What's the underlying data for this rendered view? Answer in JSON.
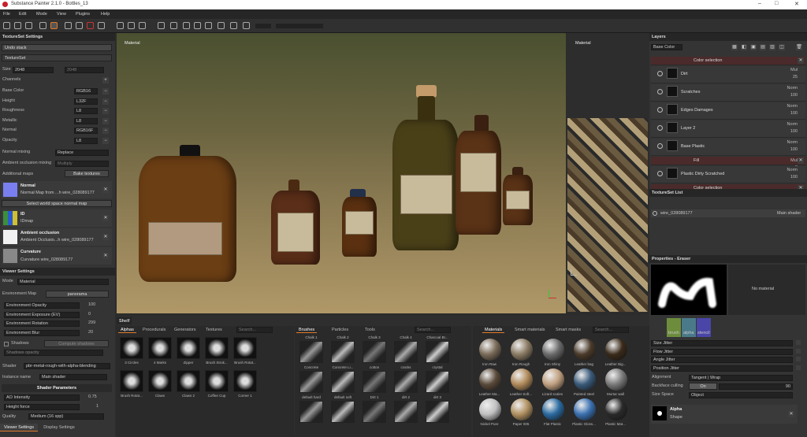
{
  "app": {
    "title": "Substance Painter 2.1.0 - Bottles_13"
  },
  "menu": [
    "File",
    "Edit",
    "Mode",
    "View",
    "Plugins",
    "Help"
  ],
  "textureset_settings": {
    "title": "TextureSet Settings",
    "undo": "Undo stack",
    "tab": "TextureSet",
    "size_label": "Size",
    "size_value": "2048",
    "size_value2": "2048",
    "channels_label": "Channels",
    "channels": [
      {
        "name": "Base Color",
        "format": "RGB16"
      },
      {
        "name": "Height",
        "format": "L32F"
      },
      {
        "name": "Roughness",
        "format": "L8"
      },
      {
        "name": "Metallic",
        "format": "L8"
      },
      {
        "name": "Normal",
        "format": "RGB16F"
      },
      {
        "name": "Opacity",
        "format": "L8"
      }
    ],
    "normal_mixing_label": "Normal mixing",
    "normal_mixing": "Replace",
    "ao_mixing_label": "Ambient occlusion mixing",
    "ao_mixing": "Multiply",
    "additional_maps": "Additional maps",
    "bake_btn": "Bake textures",
    "maps": [
      {
        "title": "Normal",
        "desc": "Normal Map from ...h wire_028089177"
      },
      {
        "title": "ID",
        "desc": "IDmap"
      },
      {
        "title": "Ambient occlusion",
        "desc": "Ambient Occlusio...h wire_028089177"
      },
      {
        "title": "Curvature",
        "desc": "Curvature wire_028089177"
      }
    ],
    "world_btn": "Select world space normal map"
  },
  "viewer_settings": {
    "title": "Viewer Settings",
    "mode_label": "Mode",
    "mode": "Material",
    "env_map_label": "Environment Map",
    "env_map": "panorama",
    "sliders": [
      {
        "label": "Environment Opacity",
        "value": "100"
      },
      {
        "label": "Environment Exposure (EV)",
        "value": "0"
      },
      {
        "label": "Environment Rotation",
        "value": "299"
      },
      {
        "label": "Environment Blur",
        "value": "20"
      }
    ],
    "shadows_label": "Shadows",
    "shadows_btn": "Compute shadows",
    "shadows_opacity": "Shadows opacity",
    "shader_label": "Shader",
    "shader_value": "pbr-metal-rough-with-alpha-blending",
    "instance_label": "Instance name",
    "instance_value": "Main shader",
    "params_title": "Shader Parameters",
    "ao_label": "AO Intensity",
    "ao_value": "0.75",
    "height_label": "Height force",
    "height_value": "1",
    "quality_label": "Quality",
    "quality_value": "Medium (16 spp)",
    "tab1": "Viewer Settings",
    "tab2": "Display Settings"
  },
  "viewport": {
    "label3d": "Material",
    "label2d": "Material"
  },
  "shelf": {
    "title": "Shelf",
    "tabs": [
      "Alphas",
      "Procedurals",
      "Generators",
      "Textures"
    ],
    "search": "Search...",
    "alphas": [
      "3 Circles",
      "4 Marks",
      "Zipper",
      "Brush Strok...",
      "Brush Rotat...",
      "Brush Rotat...",
      "Claws",
      "Claws 2",
      "Coffee Cup",
      "Corner 1"
    ],
    "brush_tabs": [
      "Brushes",
      "Particles",
      "Tools"
    ],
    "brushes": [
      "Chalk 1",
      "Chalk 2",
      "Chalk 3",
      "Chalk 4",
      "Charcoal Br...",
      "Concrete",
      "Concrete Li...",
      "cotton",
      "cracks",
      "crystal",
      "default hard",
      "default soft",
      "Dirt 1",
      "dirt 2",
      "dirt 3"
    ],
    "mat_tabs": [
      "Materials",
      "Smart materials",
      "Smart masks"
    ],
    "materials": [
      "Iron Raw",
      "Iron Rough",
      "Iron Shiny",
      "Leather bag",
      "Leather Big...",
      "Leather Ma...",
      "Leather Soft...",
      "Lizard scales",
      "Painted steel",
      "Mortar wall",
      "Nickel Pure",
      "Paper 005",
      "Flat Plastic",
      "Plastic Gloss...",
      "Plastic Mat..."
    ]
  },
  "layers": {
    "title": "Layers",
    "channel": "Base Color",
    "items": [
      {
        "name": "Color selection",
        "blend": "",
        "op": "",
        "type": "fx"
      },
      {
        "name": "Dirt",
        "blend": "Mul",
        "op": "25",
        "type": "layer"
      },
      {
        "name": "Scratches",
        "blend": "Norm",
        "op": "100",
        "type": "layer"
      },
      {
        "name": "Edges Damages",
        "blend": "Norm",
        "op": "100",
        "type": "layer"
      },
      {
        "name": "Layer 2",
        "blend": "Norm",
        "op": "100",
        "type": "layer"
      },
      {
        "name": "Base Plastic",
        "blend": "Norm",
        "op": "100",
        "type": "layer"
      },
      {
        "name": "Fill",
        "blend": "Mul",
        "op": "8",
        "type": "fx"
      },
      {
        "name": "Plastic Dirty Scratched",
        "blend": "Norm",
        "op": "100",
        "type": "folder"
      },
      {
        "name": "Color selection",
        "blend": "",
        "op": "",
        "type": "fx"
      }
    ]
  },
  "textureset_list": {
    "title": "TextureSet List",
    "item": "wire_028089177",
    "shader": "Main shader"
  },
  "properties": {
    "title": "Properties - Eraser",
    "no_material": "No material",
    "channel_tiles": [
      "brush",
      "alpha",
      "stencil"
    ],
    "jitters": [
      "Size Jitter",
      "Flow Jitter",
      "Angle Jitter",
      "Position Jitter"
    ],
    "alignment_label": "Alignment",
    "alignment": "Tangent | Wrap",
    "culling_label": "Backface culling",
    "culling_state": "On",
    "culling_value": "90",
    "space_label": "Size Space",
    "space_value": "Object",
    "alpha_title": "Alpha",
    "alpha_sub": "Shape"
  }
}
